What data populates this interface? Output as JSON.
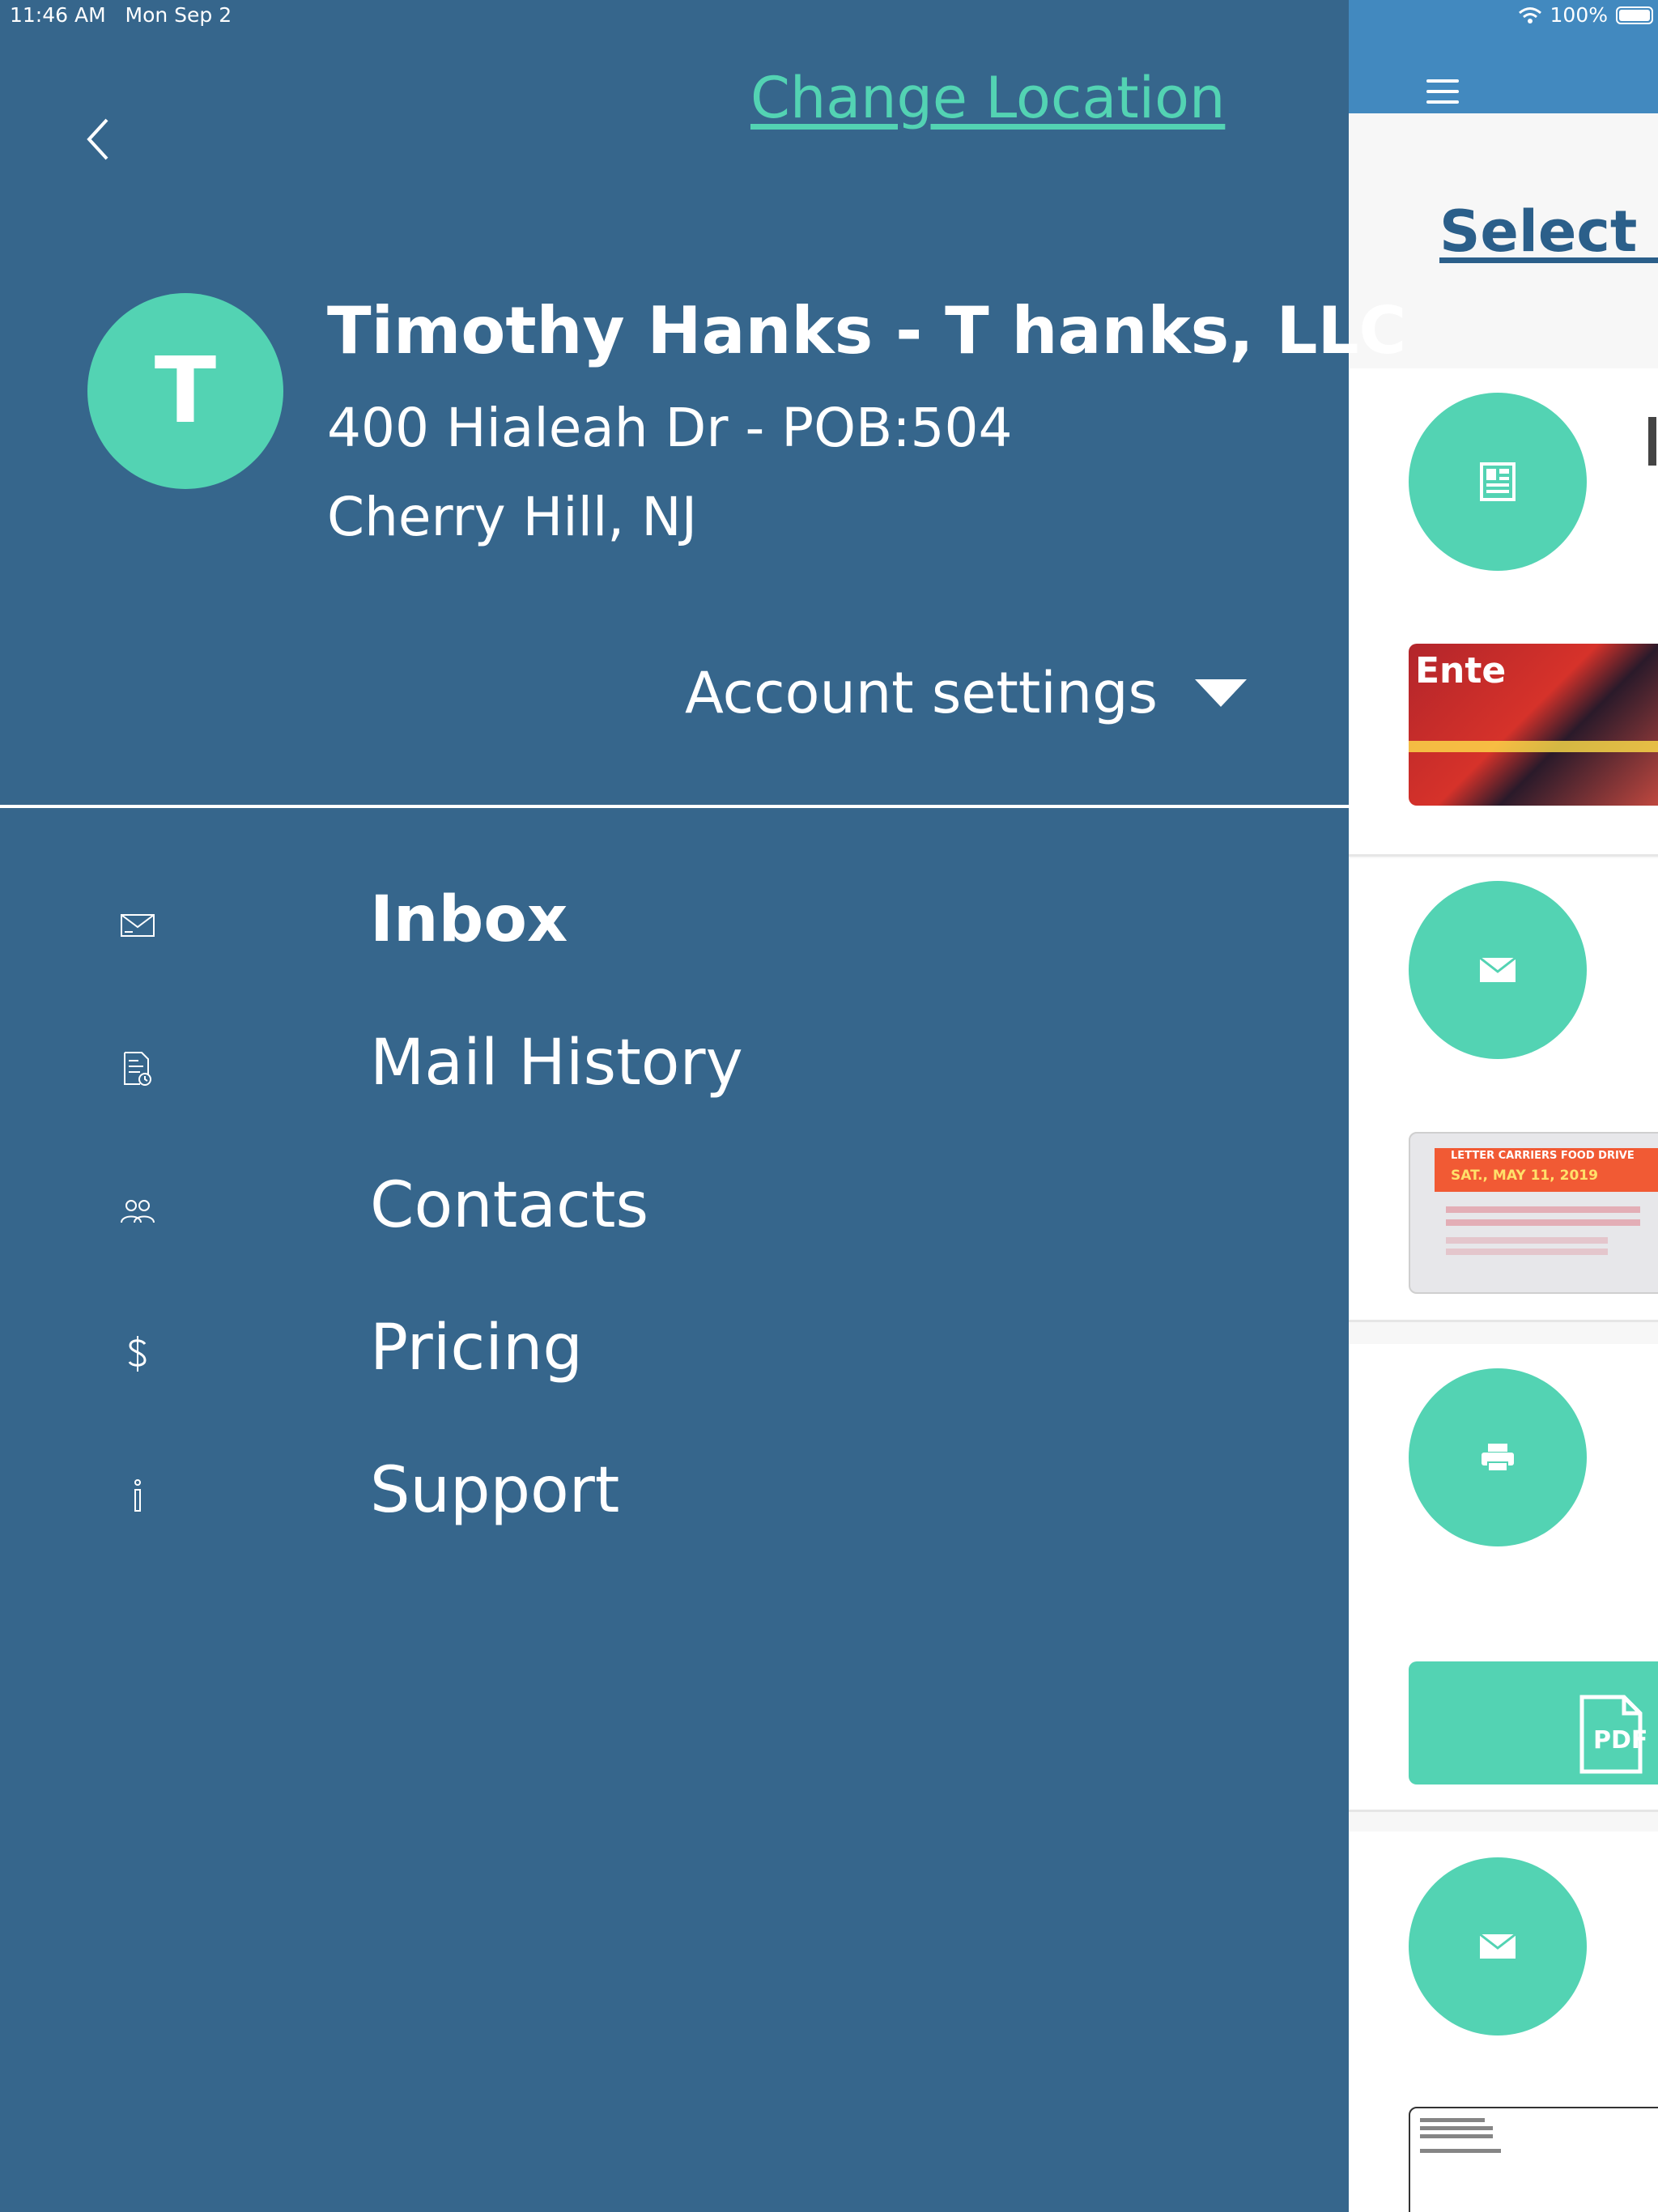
{
  "status_bar": {
    "time": "11:46 AM",
    "date": "Mon Sep 2",
    "battery": "100%"
  },
  "drawer": {
    "change_location": "Change Location",
    "avatar_initial": "T",
    "user_name": "Timothy Hanks - T hanks, LLC",
    "address_line1": "400 Hialeah Dr - POB:504",
    "address_line2": "Cherry Hill, NJ",
    "account_settings": "Account settings",
    "menu": [
      {
        "label": "Inbox",
        "icon": "envelope-icon"
      },
      {
        "label": "Mail History",
        "icon": "document-clock-icon"
      },
      {
        "label": "Contacts",
        "icon": "people-icon"
      },
      {
        "label": "Pricing",
        "icon": "dollar-icon"
      },
      {
        "label": "Support",
        "icon": "info-icon"
      }
    ]
  },
  "main": {
    "heading": "Select a",
    "thumbs": {
      "magazine_text": "Ente",
      "flyer_title": "LETTER CARRIERS FOOD DRIVE",
      "flyer_date": "SAT., MAY 11, 2019",
      "pdf_label": "PDF"
    }
  },
  "colors": {
    "drawer_bg": "#36668c",
    "accent": "#53d3b3",
    "nav_bar": "#4289bf",
    "heading": "#2b5f8a"
  }
}
